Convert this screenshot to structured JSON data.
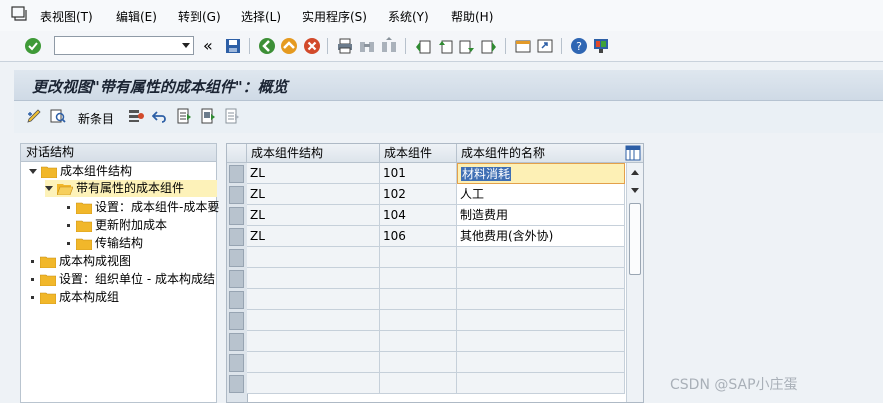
{
  "menu": {
    "items": [
      "表视图(T)",
      "编辑(E)",
      "转到(G)",
      "选择(L)",
      "实用程序(S)",
      "系统(Y)",
      "帮助(H)"
    ]
  },
  "toolbar": {
    "command_value": ""
  },
  "page": {
    "title": "更改视图\"带有属性的成本组件\"：概览"
  },
  "app_toolbar": {
    "new_entries": "新条目"
  },
  "tree": {
    "header": "对话结构",
    "nodes": [
      {
        "label": "成本组件结构"
      },
      {
        "label": "带有属性的成本组件"
      },
      {
        "label": "设置：成本组件-成本要"
      },
      {
        "label": "更新附加成本"
      },
      {
        "label": "传输结构"
      },
      {
        "label": "成本构成视图"
      },
      {
        "label": "设置：组织单位 - 成本构成结"
      },
      {
        "label": "成本构成组"
      }
    ]
  },
  "table": {
    "columns": [
      "成本组件结构",
      "成本组件",
      "成本组件的名称"
    ],
    "rows": [
      [
        "ZL",
        "101",
        "材料消耗"
      ],
      [
        "ZL",
        "102",
        "人工"
      ],
      [
        "ZL",
        "104",
        "制造费用"
      ],
      [
        "ZL",
        "106",
        "其他费用(含外协)"
      ]
    ]
  },
  "watermark": "CSDN @SAP小庄蛋",
  "colors": {
    "selected_node": "#fdf2b9",
    "focus_cell": "#fdf0b5",
    "title_bg": "#cfdae6"
  }
}
